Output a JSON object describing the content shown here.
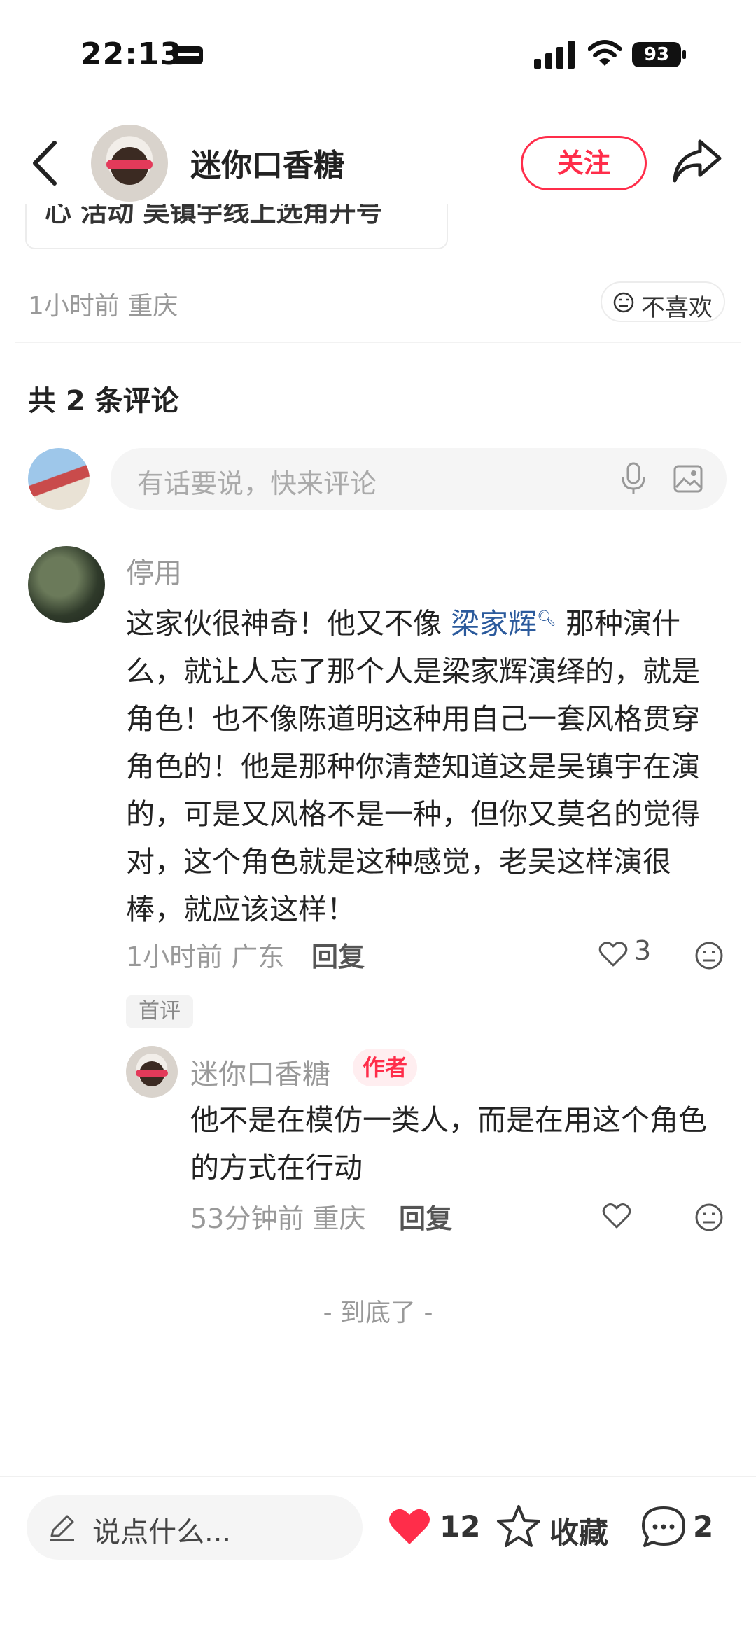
{
  "status_bar": {
    "time": "22:13",
    "battery": "93"
  },
  "header": {
    "author_name": "迷你口香糖",
    "follow_label": "关注"
  },
  "post": {
    "partial_card_text": "心 活动  吴镇宇线上选角开号",
    "time": "1小时前",
    "location": "重庆",
    "dislike_label": "不喜欢"
  },
  "comments": {
    "count_label": "共 2 条评论",
    "input_placeholder": "有话要说，快来评论",
    "items": [
      {
        "name": "停用",
        "text_before": "这家伙很神奇！他又不像 ",
        "highlight": "梁家辉",
        "text_after": " 那种演什么，就让人忘了那个人是梁家辉演绎的，就是角色！也不像陈道明这种用自己一套风格贯穿角色的！他是那种你清楚知道这是吴镇宇在演的，可是又风格不是一种，但你又莫名的觉得对，这个角色就是这种感觉，老吴这样演很棒，就应该这样！",
        "time": "1小时前",
        "location": "广东",
        "reply_label": "回复",
        "likes": "3",
        "badge": "首评"
      }
    ],
    "reply": {
      "name": "迷你口香糖",
      "tag": "作者",
      "text": "他不是在模仿一类人，而是在用这个角色的方式在行动",
      "time": "53分钟前",
      "location": "重庆",
      "reply_label": "回复"
    },
    "end_label": "- 到底了 -"
  },
  "bottom_bar": {
    "input_placeholder": "说点什么...",
    "likes": "12",
    "favorite_label": "收藏",
    "comments": "2"
  },
  "colors": {
    "accent": "#ff2d4a",
    "link": "#2b5a9c"
  }
}
